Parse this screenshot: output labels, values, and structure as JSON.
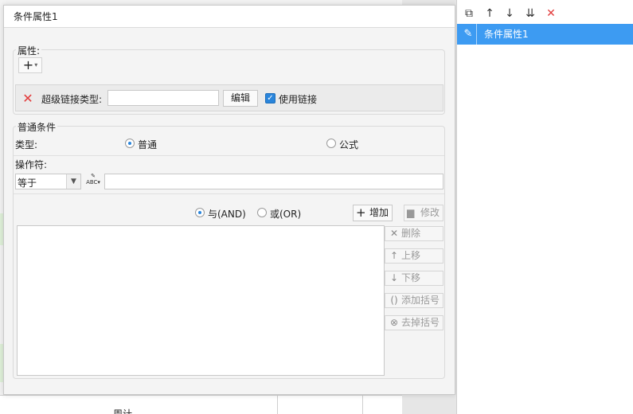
{
  "background": {
    "cell_text": "周计"
  },
  "dialog": {
    "title": "条件属性1",
    "property_group": {
      "label": "属性:",
      "add_symbol": "+",
      "hyperlink_type_label": "超级链接类型:",
      "hyperlink_type_value": "",
      "edit_button": "编辑",
      "use_link_label": "使用链接",
      "use_link_checked": true
    },
    "condition_group": {
      "label": "普通条件",
      "type_label": "类型:",
      "type_options": [
        "普通",
        "公式"
      ],
      "type_selected": "普通",
      "operator_label": "操作符:",
      "operator_value": "等于",
      "operand_value": "",
      "logic_options": [
        "与(AND)",
        "或(OR)"
      ],
      "logic_selected": "与(AND)",
      "add_button": "增加",
      "modify_button": "修改",
      "delete_button": "删除",
      "move_up_button": "上移",
      "move_down_button": "下移",
      "add_bracket_button": "添加括号",
      "remove_bracket_button": "去掉括号"
    }
  },
  "right_panel": {
    "items": [
      "条件属性1"
    ],
    "selected_index": 0
  },
  "colors": {
    "accent": "#3d9bf2",
    "delete_red": "#e23b3b",
    "checkbox_blue": "#2a85db"
  }
}
